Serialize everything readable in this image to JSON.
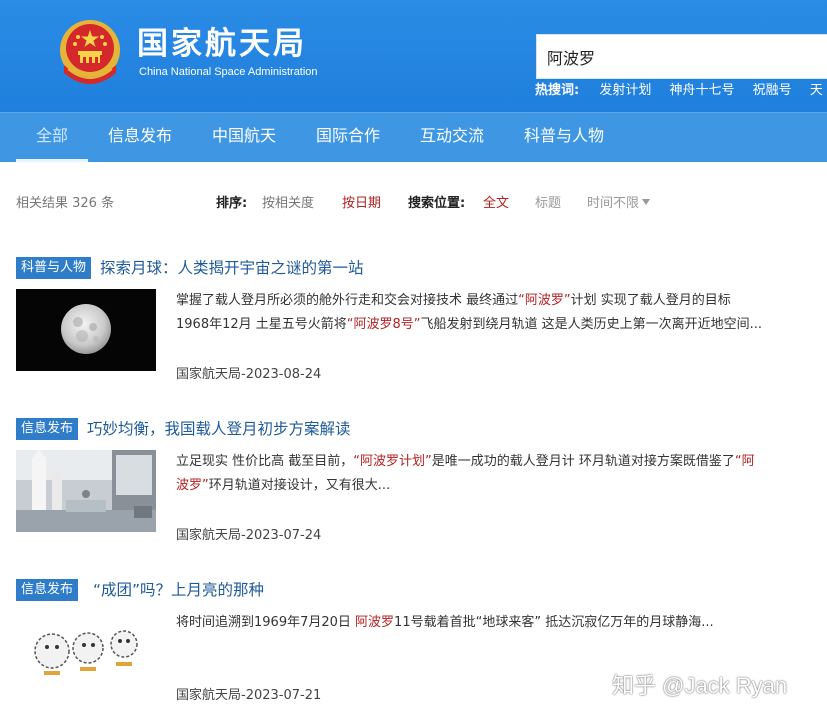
{
  "header": {
    "site_title": "国家航天局",
    "site_subtitle": "China National Space Administration",
    "brand_color": "#1f7fdc"
  },
  "search": {
    "value": "阿波罗",
    "hot_label": "热搜词:",
    "hot_words": [
      "发射计划",
      "神舟十七号",
      "祝融号",
      "天"
    ]
  },
  "nav": {
    "items": [
      "全部",
      "信息发布",
      "中国航天",
      "国际合作",
      "互动交流",
      "科普与人物"
    ],
    "active": "全部"
  },
  "results_bar": {
    "count_text": "相关结果 326 条",
    "sort_label": "排序:",
    "sort_relevance": "按相关度",
    "sort_date": "按日期",
    "position_label": "搜索位置:",
    "position_full": "全文",
    "position_title": "标题",
    "time_filter": "时间不限"
  },
  "results": [
    {
      "category": "科普与人物",
      "title": "探索月球：人类揭开宇宙之谜的第一站",
      "thumb_icon": "moon-image",
      "snippet": [
        {
          "t": "掌握了载人登月所必须的舱外行走和交会对接技术 最终通过"
        },
        {
          "t": "“阿波罗”",
          "hl": true
        },
        {
          "t": "计划 实现了载人登月的目标 1968年12月 土星五号火箭将"
        },
        {
          "t": "“阿波罗8号”",
          "hl": true
        },
        {
          "t": "飞船发射到绕月轨道 这是人类历史上第一次离开近地空间..."
        }
      ],
      "source": "国家航天局-2023-08-24"
    },
    {
      "category": "信息发布",
      "title": "巧妙均衡，我国载人登月初步方案解读",
      "thumb_icon": "exhibition-hall-image",
      "snippet": [
        {
          "t": "立足现实 性价比高 截至目前，"
        },
        {
          "t": "“阿波罗计划”",
          "hl": true
        },
        {
          "t": "是唯一成功的载人登月计 环月轨道对接方案既借鉴了"
        },
        {
          "t": "“阿波罗”",
          "hl": true
        },
        {
          "t": "环月轨道对接设计，又有很大..."
        }
      ],
      "source": "国家航天局-2023-07-24"
    },
    {
      "category": "信息发布",
      "title": "“成团”吗？上月亮的那种",
      "thumb_icon": "cartoon-spheres-image",
      "snippet": [
        {
          "t": "将时间追溯到1969年7月20日 "
        },
        {
          "t": "阿波罗",
          "hl": true
        },
        {
          "t": "11号载着首批“地球来客” 抵达沉寂亿万年的月球静海..."
        }
      ],
      "source": "国家航天局-2023-07-21"
    }
  ],
  "watermark": "知乎 @Jack Ryan",
  "colors": {
    "highlight": "#b22222",
    "category_badge": "#2f7cc8",
    "title_link": "#1f5a99"
  }
}
